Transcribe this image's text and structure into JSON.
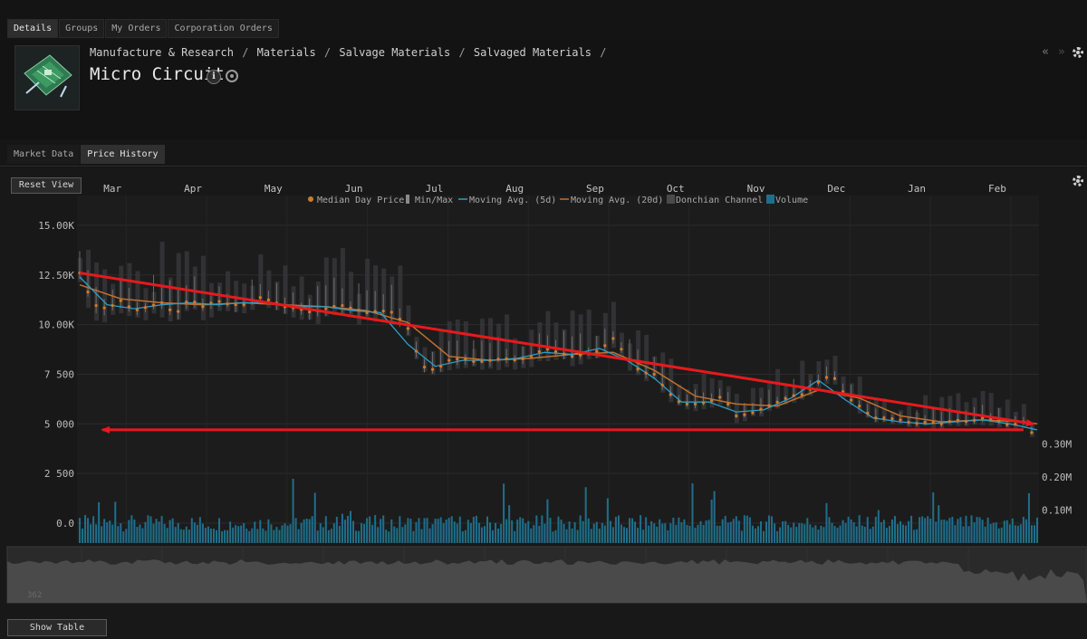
{
  "tabs": [
    "Details",
    "Groups",
    "My Orders",
    "Corporation Orders"
  ],
  "breadcrumb": [
    "Manufacture & Research",
    "Materials",
    "Salvage Materials",
    "Salvaged Materials"
  ],
  "breadcrumb_sep": "/",
  "item_title": "Micro Circuit",
  "subtabs": [
    "Market Data",
    "Price History"
  ],
  "reset_view_label": "Reset View",
  "show_table_label": "Show Table",
  "navigator_label": "362",
  "icons": {
    "info": "info-icon",
    "wreck": "wreck-icon",
    "gear": "gear-icon",
    "collapse": "double-chevron-left-icon",
    "expand": "double-chevron-right-icon"
  },
  "colors": {
    "median": "#d07a2a",
    "minmax": "#8a8a8a",
    "ma5": "#2e9ec6",
    "ma20": "#c07030",
    "donchian": "#3a3a3e",
    "volume": "#1f6f8c",
    "annotation": "#e8191c"
  },
  "chart_data": {
    "type": "line",
    "months": [
      "Mar",
      "Apr",
      "May",
      "Jun",
      "Jul",
      "Aug",
      "Sep",
      "Oct",
      "Nov",
      "Dec",
      "Jan",
      "Feb"
    ],
    "legend": [
      "Median Day Price",
      "Min/Max",
      "Moving Avg. (5d)",
      "Moving Avg. (20d)",
      "Donchian Channel",
      "Volume"
    ],
    "y_ticks": [
      "0.0",
      "2 500",
      "5 000",
      "7 500",
      "10.00K",
      "12.50K",
      "15.00K"
    ],
    "y_range": [
      0,
      16500
    ],
    "volume_ticks": [
      "0.10M",
      "0.20M",
      "0.30M"
    ],
    "volume_range": [
      0,
      0.34
    ],
    "grid": true,
    "legend_position": "top",
    "median_price": [
      [
        0,
        12600
      ],
      [
        5,
        11000
      ],
      [
        10,
        10800
      ],
      [
        15,
        11200
      ],
      [
        20,
        10700
      ],
      [
        25,
        10900
      ],
      [
        30,
        11100
      ],
      [
        35,
        10500
      ],
      [
        40,
        11300
      ],
      [
        45,
        10900
      ],
      [
        50,
        11200
      ],
      [
        55,
        11000
      ],
      [
        60,
        11000
      ],
      [
        65,
        11400
      ],
      [
        70,
        11200
      ],
      [
        75,
        10900
      ],
      [
        80,
        10800
      ],
      [
        85,
        10600
      ],
      [
        90,
        10800
      ],
      [
        95,
        11000
      ],
      [
        100,
        10800
      ],
      [
        105,
        10600
      ],
      [
        110,
        10700
      ],
      [
        115,
        10600
      ],
      [
        120,
        9800
      ],
      [
        125,
        7900
      ],
      [
        130,
        7700
      ],
      [
        135,
        8200
      ],
      [
        140,
        8300
      ],
      [
        145,
        8100
      ],
      [
        150,
        8200
      ],
      [
        155,
        8300
      ],
      [
        160,
        8200
      ],
      [
        165,
        8400
      ],
      [
        170,
        8800
      ],
      [
        175,
        8600
      ],
      [
        180,
        8400
      ],
      [
        185,
        8500
      ],
      [
        190,
        8700
      ],
      [
        195,
        9300
      ],
      [
        200,
        8400
      ],
      [
        205,
        7600
      ],
      [
        210,
        7500
      ],
      [
        215,
        6600
      ],
      [
        220,
        6000
      ],
      [
        225,
        6000
      ],
      [
        230,
        6100
      ],
      [
        235,
        6400
      ],
      [
        240,
        5400
      ],
      [
        245,
        5500
      ],
      [
        250,
        5800
      ],
      [
        255,
        6100
      ],
      [
        260,
        6400
      ],
      [
        265,
        6500
      ],
      [
        270,
        7100
      ],
      [
        275,
        7500
      ],
      [
        280,
        6400
      ],
      [
        285,
        5900
      ],
      [
        290,
        5300
      ],
      [
        295,
        5300
      ],
      [
        300,
        5200
      ],
      [
        305,
        5000
      ],
      [
        310,
        5100
      ],
      [
        315,
        5000
      ],
      [
        320,
        5200
      ],
      [
        325,
        5100
      ],
      [
        330,
        5300
      ],
      [
        335,
        5200
      ],
      [
        340,
        4900
      ],
      [
        345,
        5100
      ],
      [
        350,
        4200
      ]
    ],
    "moving_avg_5d": [
      [
        0,
        12400
      ],
      [
        10,
        11000
      ],
      [
        20,
        10800
      ],
      [
        30,
        11000
      ],
      [
        40,
        11100
      ],
      [
        50,
        11000
      ],
      [
        60,
        11100
      ],
      [
        70,
        11100
      ],
      [
        80,
        10900
      ],
      [
        90,
        10900
      ],
      [
        100,
        10700
      ],
      [
        110,
        10600
      ],
      [
        120,
        9000
      ],
      [
        130,
        7900
      ],
      [
        140,
        8200
      ],
      [
        150,
        8200
      ],
      [
        160,
        8300
      ],
      [
        170,
        8600
      ],
      [
        180,
        8500
      ],
      [
        190,
        8800
      ],
      [
        200,
        8200
      ],
      [
        210,
        7300
      ],
      [
        220,
        6100
      ],
      [
        230,
        6100
      ],
      [
        240,
        5600
      ],
      [
        250,
        5700
      ],
      [
        260,
        6300
      ],
      [
        270,
        7200
      ],
      [
        280,
        6200
      ],
      [
        290,
        5300
      ],
      [
        300,
        5100
      ],
      [
        310,
        5000
      ],
      [
        320,
        5100
      ],
      [
        330,
        5200
      ],
      [
        340,
        5000
      ],
      [
        350,
        4700
      ]
    ],
    "moving_avg_20d": [
      [
        0,
        12000
      ],
      [
        15,
        11300
      ],
      [
        30,
        11100
      ],
      [
        45,
        11000
      ],
      [
        60,
        11100
      ],
      [
        75,
        11000
      ],
      [
        90,
        10900
      ],
      [
        105,
        10700
      ],
      [
        120,
        10100
      ],
      [
        135,
        8400
      ],
      [
        150,
        8200
      ],
      [
        165,
        8300
      ],
      [
        180,
        8500
      ],
      [
        195,
        8600
      ],
      [
        210,
        7700
      ],
      [
        225,
        6400
      ],
      [
        240,
        6000
      ],
      [
        255,
        5900
      ],
      [
        270,
        6700
      ],
      [
        285,
        6300
      ],
      [
        300,
        5400
      ],
      [
        315,
        5100
      ],
      [
        330,
        5200
      ],
      [
        345,
        5100
      ],
      [
        350,
        5000
      ]
    ],
    "annotation_trend_line": [
      [
        0,
        12600
      ],
      [
        350,
        5000
      ]
    ],
    "annotation_level_line": [
      [
        5,
        4700
      ],
      [
        345,
        4700
      ]
    ]
  }
}
